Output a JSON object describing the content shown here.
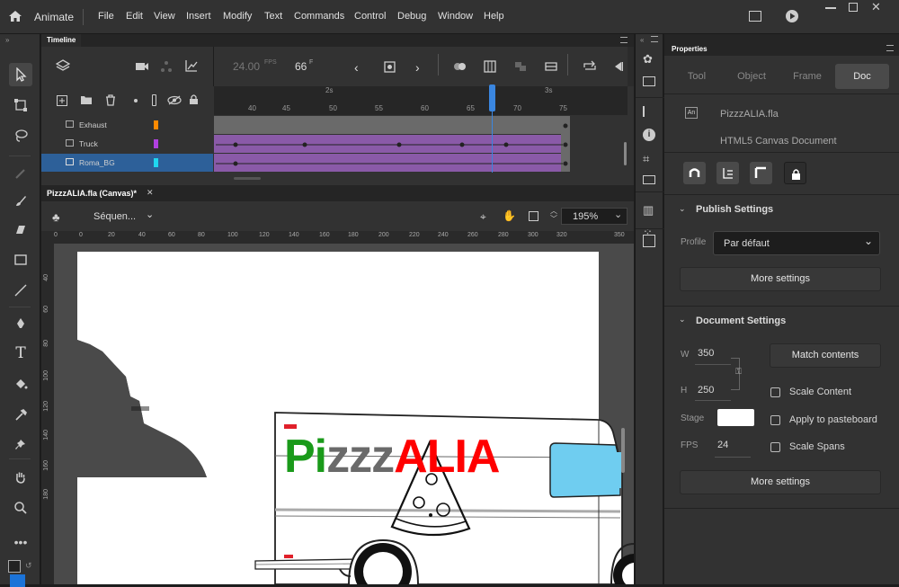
{
  "app": {
    "name": "Animate"
  },
  "menu": [
    "File",
    "Edit",
    "View",
    "Insert",
    "Modify",
    "Text",
    "Commands",
    "Control",
    "Debug",
    "Window",
    "Help"
  ],
  "timeline": {
    "tab": "Timeline",
    "fps": "24.00",
    "fps_unit": "FPS",
    "frame": "66",
    "frame_unit": "F",
    "ruler_seconds": [
      "2s",
      "3s"
    ],
    "ruler_frames": [
      "40",
      "45",
      "50",
      "55",
      "60",
      "65",
      "70",
      "75"
    ],
    "layers": [
      {
        "name": "Exhaust",
        "color": "#ff8a00"
      },
      {
        "name": "Truck",
        "color": "#b040e0"
      },
      {
        "name": "Roma_BG",
        "color": "#1fd7f0"
      }
    ]
  },
  "document": {
    "tab": "PizzzALIA.fla (Canvas)*",
    "scene": "Séquen...",
    "zoom": "195%",
    "hruler": [
      "0",
      "0",
      "20",
      "40",
      "60",
      "80",
      "100",
      "120",
      "140",
      "160",
      "180",
      "200",
      "220",
      "240",
      "260",
      "280",
      "300",
      "320",
      "350"
    ],
    "vruler": [
      "40",
      "60",
      "80",
      "100",
      "120",
      "140",
      "160",
      "180"
    ],
    "logo": {
      "part1": "Pi",
      "part2": "zzz",
      "part3": "ALIA",
      "green": "#1a9a1a",
      "grey": "#777777",
      "red": "#ff0000"
    }
  },
  "properties": {
    "title": "Properties",
    "tabs": [
      "Tool",
      "Object",
      "Frame",
      "Doc"
    ],
    "active_tab": "Doc",
    "file_badge": "An",
    "file_name": "PizzzALIA.fla",
    "doc_type": "HTML5 Canvas Document",
    "publish": {
      "title": "Publish Settings",
      "profile_label": "Profile",
      "profile_value": "Par défaut",
      "more": "More settings"
    },
    "docsettings": {
      "title": "Document Settings",
      "w_label": "W",
      "w": "350",
      "h_label": "H",
      "h": "250",
      "match": "Match contents",
      "stage_label": "Stage",
      "stage_color": "#ffffff",
      "fps_label": "FPS",
      "fps": "24",
      "scale_content": "Scale Content",
      "apply_paste": "Apply to pasteboard",
      "scale_spans": "Scale Spans",
      "more": "More settings"
    }
  },
  "colors": {
    "accent": "#2d6099",
    "playhead": "#3a86e0",
    "tween": "#8a5aa8"
  }
}
